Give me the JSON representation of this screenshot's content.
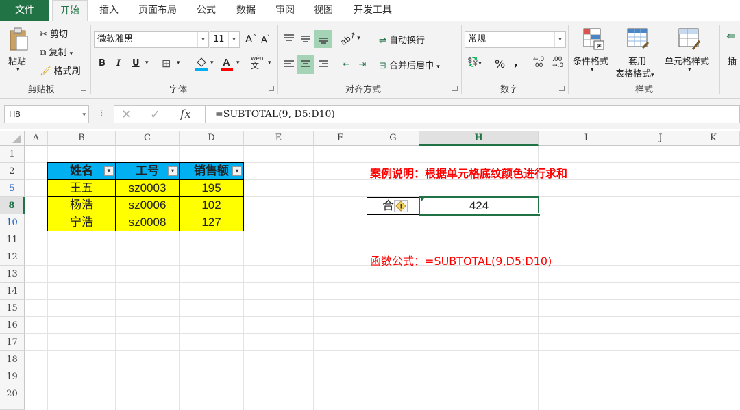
{
  "tabs": [
    "文件",
    "开始",
    "插入",
    "页面布局",
    "公式",
    "数据",
    "审阅",
    "视图",
    "开发工具"
  ],
  "ribbon": {
    "clipboard": {
      "paste": "粘贴",
      "cut": "剪切",
      "copy": "复制",
      "format_painter": "格式刷",
      "label": "剪贴板"
    },
    "font": {
      "name": "微软雅黑",
      "size": "11",
      "bold": "B",
      "italic": "I",
      "underline": "U",
      "grow": "A",
      "shrink": "A",
      "phonetic": "wén",
      "label": "字体"
    },
    "alignment": {
      "wrap": "自动换行",
      "merge": "合并后居中",
      "label": "对齐方式"
    },
    "number": {
      "format": "常规",
      "percent": "%",
      "comma": ",",
      "label": "数字"
    },
    "styles": {
      "conditional": "条件格式",
      "table_line1": "套用",
      "table_line2": "表格格式",
      "cell_styles": "单元格样式",
      "label": "样式"
    },
    "insert": "插"
  },
  "formula_bar": {
    "name_box": "H8",
    "cancel": "✕",
    "enter": "✓",
    "fx": "fx",
    "formula": "=SUBTOTAL(9, D5:D10)"
  },
  "columns": [
    "A",
    "B",
    "C",
    "D",
    "E",
    "F",
    "G",
    "H",
    "I",
    "J",
    "K"
  ],
  "rows": [
    "1",
    "2",
    "5",
    "8",
    "10",
    "11",
    "12",
    "13",
    "14",
    "15",
    "16",
    "17",
    "18",
    "19",
    "20"
  ],
  "table": {
    "headers": [
      "姓名",
      "工号",
      "销售额"
    ],
    "rows": [
      [
        "王五",
        "sz0003",
        "195"
      ],
      [
        "杨浩",
        "sz0006",
        "102"
      ],
      [
        "宁浩",
        "sz0008",
        "127"
      ]
    ]
  },
  "notes": {
    "case": "案例说明：根据单元格底纹颜色进行求和",
    "sum_label": "合",
    "sum_value": "424",
    "formula_text": "函数公式：=SUBTOTAL(9,D5:D10)"
  },
  "colors": {
    "excel_green": "#217346",
    "header_blue": "#00b0f0",
    "highlight_yellow": "#ffff00",
    "note_red": "#ff0000"
  }
}
